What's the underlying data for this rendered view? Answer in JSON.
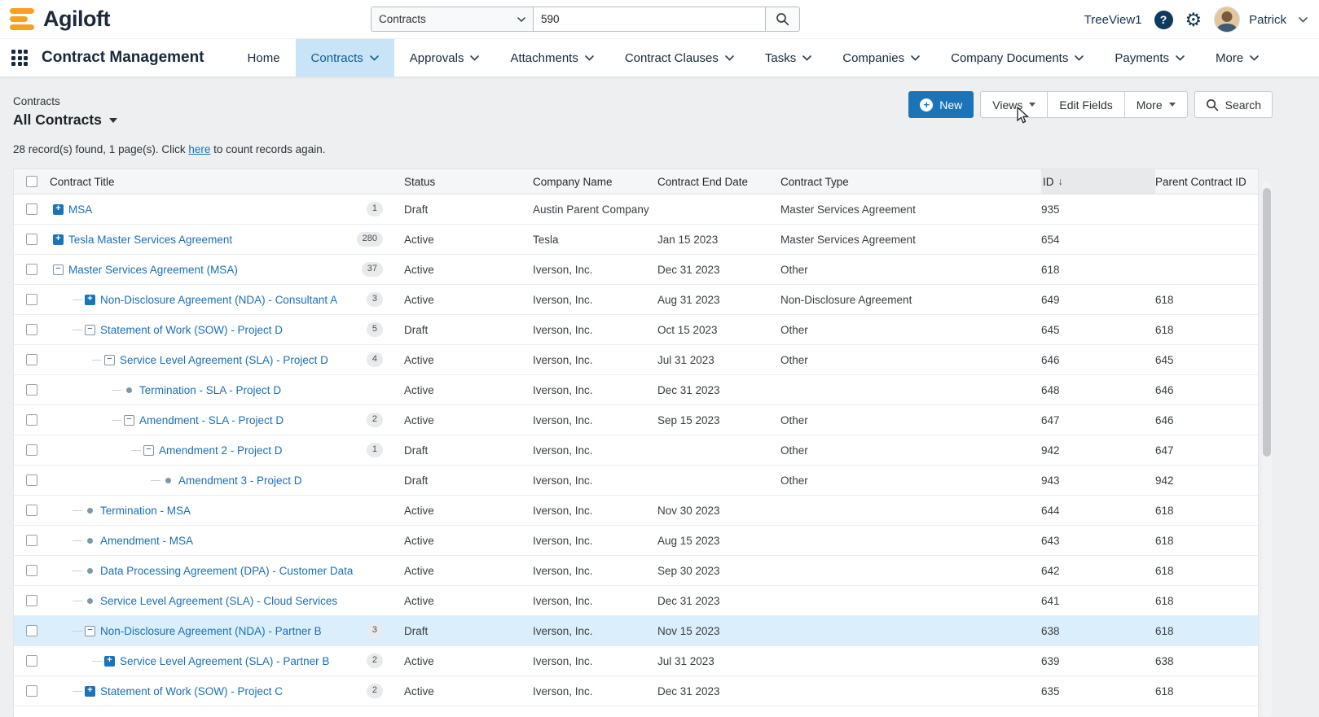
{
  "colors": {
    "accent": "#1b74b8",
    "orange": "#f6a21e",
    "active_tab_bg": "#c9e4f6",
    "link": "#1a6fb5",
    "highlight_row": "#dbeefb"
  },
  "topbar": {
    "logo_text": "Agiloft",
    "search": {
      "scope": "Contracts",
      "value": "590"
    },
    "treeview_label": "TreeView1",
    "user_name": "Patrick"
  },
  "nav": {
    "app_title": "Contract Management",
    "items": [
      {
        "label": "Home",
        "chevron": false,
        "active": false
      },
      {
        "label": "Contracts",
        "chevron": true,
        "active": true
      },
      {
        "label": "Approvals",
        "chevron": true,
        "active": false
      },
      {
        "label": "Attachments",
        "chevron": true,
        "active": false
      },
      {
        "label": "Contract Clauses",
        "chevron": true,
        "active": false
      },
      {
        "label": "Tasks",
        "chevron": true,
        "active": false
      },
      {
        "label": "Companies",
        "chevron": true,
        "active": false
      },
      {
        "label": "Company Documents",
        "chevron": true,
        "active": false
      },
      {
        "label": "Payments",
        "chevron": true,
        "active": false
      },
      {
        "label": "More",
        "chevron": true,
        "active": false
      }
    ]
  },
  "page": {
    "section_label": "Contracts",
    "view_title": "All Contracts",
    "record_info": {
      "prefix": "28 record(s) found, 1 page(s). Click ",
      "link": "here",
      "suffix": " to count records again."
    },
    "toolbar": {
      "new": "New",
      "views": "Views",
      "edit_fields": "Edit Fields",
      "more": "More",
      "search": "Search"
    }
  },
  "table": {
    "headers": {
      "title": "Contract Title",
      "status": "Status",
      "company": "Company Name",
      "end_date": "Contract End Date",
      "type": "Contract Type",
      "id": "ID",
      "parent_id": "Parent Contract ID"
    },
    "sort": {
      "column": "ID",
      "direction": "desc",
      "indicator": "↓"
    },
    "rows": [
      {
        "title": "MSA",
        "icon": "plus",
        "level": 0,
        "badge": "1",
        "status": "Draft",
        "company": "Austin Parent Company",
        "end_date": "",
        "type": "Master Services Agreement",
        "id": "935",
        "parent_id": "",
        "highlighted": false
      },
      {
        "title": "Tesla Master Services Agreement",
        "icon": "plus",
        "level": 0,
        "badge": "280",
        "status": "Active",
        "company": "Tesla",
        "end_date": "Jan 15 2023",
        "type": "Master Services Agreement",
        "id": "654",
        "parent_id": "",
        "highlighted": false
      },
      {
        "title": "Master Services Agreement (MSA)",
        "icon": "minus",
        "level": 0,
        "badge": "37",
        "status": "Active",
        "company": "Iverson, Inc.",
        "end_date": "Dec 31 2023",
        "type": "Other",
        "id": "618",
        "parent_id": "",
        "highlighted": false
      },
      {
        "title": "Non-Disclosure Agreement (NDA) - Consultant A",
        "icon": "plus",
        "level": 1,
        "badge": "3",
        "status": "Active",
        "company": "Iverson, Inc.",
        "end_date": "Aug 31 2023",
        "type": "Non-Disclosure Agreement",
        "id": "649",
        "parent_id": "618",
        "highlighted": false
      },
      {
        "title": "Statement of Work (SOW) - Project D",
        "icon": "minus",
        "level": 1,
        "badge": "5",
        "status": "Draft",
        "company": "Iverson, Inc.",
        "end_date": "Oct 15 2023",
        "type": "Other",
        "id": "645",
        "parent_id": "618",
        "highlighted": false
      },
      {
        "title": "Service Level Agreement (SLA) - Project D",
        "icon": "minus",
        "level": 2,
        "badge": "4",
        "status": "Active",
        "company": "Iverson, Inc.",
        "end_date": "Jul 31 2023",
        "type": "Other",
        "id": "646",
        "parent_id": "645",
        "highlighted": false
      },
      {
        "title": "Termination - SLA - Project D",
        "icon": "leaf",
        "level": 3,
        "badge": "",
        "status": "Active",
        "company": "Iverson, Inc.",
        "end_date": "Dec 31 2023",
        "type": "",
        "id": "648",
        "parent_id": "646",
        "highlighted": false
      },
      {
        "title": "Amendment - SLA - Project D",
        "icon": "minus",
        "level": 3,
        "badge": "2",
        "status": "Active",
        "company": "Iverson, Inc.",
        "end_date": "Sep 15 2023",
        "type": "Other",
        "id": "647",
        "parent_id": "646",
        "highlighted": false
      },
      {
        "title": "Amendment 2 - Project D",
        "icon": "minus",
        "level": 4,
        "badge": "1",
        "status": "Draft",
        "company": "Iverson, Inc.",
        "end_date": "",
        "type": "Other",
        "id": "942",
        "parent_id": "647",
        "highlighted": false
      },
      {
        "title": "Amendment 3 - Project D",
        "icon": "leaf",
        "level": 5,
        "badge": "",
        "status": "Draft",
        "company": "Iverson, Inc.",
        "end_date": "",
        "type": "Other",
        "id": "943",
        "parent_id": "942",
        "highlighted": false
      },
      {
        "title": "Termination - MSA",
        "icon": "leaf",
        "level": 1,
        "badge": "",
        "status": "Active",
        "company": "Iverson, Inc.",
        "end_date": "Nov 30 2023",
        "type": "",
        "id": "644",
        "parent_id": "618",
        "highlighted": false
      },
      {
        "title": "Amendment - MSA",
        "icon": "leaf",
        "level": 1,
        "badge": "",
        "status": "Active",
        "company": "Iverson, Inc.",
        "end_date": "Aug 15 2023",
        "type": "",
        "id": "643",
        "parent_id": "618",
        "highlighted": false
      },
      {
        "title": "Data Processing Agreement (DPA) - Customer Data",
        "icon": "leaf",
        "level": 1,
        "badge": "",
        "status": "Active",
        "company": "Iverson, Inc.",
        "end_date": "Sep 30 2023",
        "type": "",
        "id": "642",
        "parent_id": "618",
        "highlighted": false
      },
      {
        "title": "Service Level Agreement (SLA) - Cloud Services",
        "icon": "leaf",
        "level": 1,
        "badge": "",
        "status": "Active",
        "company": "Iverson, Inc.",
        "end_date": "Dec 31 2023",
        "type": "",
        "id": "641",
        "parent_id": "618",
        "highlighted": false
      },
      {
        "title": "Non-Disclosure Agreement (NDA) - Partner B",
        "icon": "minus",
        "level": 1,
        "badge": "3",
        "status": "Draft",
        "company": "Iverson, Inc.",
        "end_date": "Nov 15 2023",
        "type": "",
        "id": "638",
        "parent_id": "618",
        "highlighted": true
      },
      {
        "title": "Service Level Agreement (SLA) - Partner B",
        "icon": "plus",
        "level": 2,
        "badge": "2",
        "status": "Active",
        "company": "Iverson, Inc.",
        "end_date": "Jul 31 2023",
        "type": "",
        "id": "639",
        "parent_id": "638",
        "highlighted": false
      },
      {
        "title": "Statement of Work (SOW) - Project C",
        "icon": "plus",
        "level": 1,
        "badge": "2",
        "status": "Active",
        "company": "Iverson, Inc.",
        "end_date": "Dec 31 2023",
        "type": "",
        "id": "635",
        "parent_id": "618",
        "highlighted": false
      }
    ]
  }
}
